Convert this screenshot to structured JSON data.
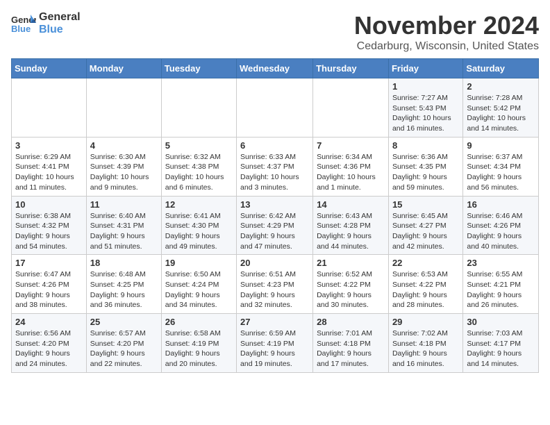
{
  "logo": {
    "general": "General",
    "blue": "Blue"
  },
  "header": {
    "month": "November 2024",
    "location": "Cedarburg, Wisconsin, United States"
  },
  "days_of_week": [
    "Sunday",
    "Monday",
    "Tuesday",
    "Wednesday",
    "Thursday",
    "Friday",
    "Saturday"
  ],
  "weeks": [
    [
      {
        "day": "",
        "info": ""
      },
      {
        "day": "",
        "info": ""
      },
      {
        "day": "",
        "info": ""
      },
      {
        "day": "",
        "info": ""
      },
      {
        "day": "",
        "info": ""
      },
      {
        "day": "1",
        "info": "Sunrise: 7:27 AM\nSunset: 5:43 PM\nDaylight: 10 hours and 16 minutes."
      },
      {
        "day": "2",
        "info": "Sunrise: 7:28 AM\nSunset: 5:42 PM\nDaylight: 10 hours and 14 minutes."
      }
    ],
    [
      {
        "day": "3",
        "info": "Sunrise: 6:29 AM\nSunset: 4:41 PM\nDaylight: 10 hours and 11 minutes."
      },
      {
        "day": "4",
        "info": "Sunrise: 6:30 AM\nSunset: 4:39 PM\nDaylight: 10 hours and 9 minutes."
      },
      {
        "day": "5",
        "info": "Sunrise: 6:32 AM\nSunset: 4:38 PM\nDaylight: 10 hours and 6 minutes."
      },
      {
        "day": "6",
        "info": "Sunrise: 6:33 AM\nSunset: 4:37 PM\nDaylight: 10 hours and 3 minutes."
      },
      {
        "day": "7",
        "info": "Sunrise: 6:34 AM\nSunset: 4:36 PM\nDaylight: 10 hours and 1 minute."
      },
      {
        "day": "8",
        "info": "Sunrise: 6:36 AM\nSunset: 4:35 PM\nDaylight: 9 hours and 59 minutes."
      },
      {
        "day": "9",
        "info": "Sunrise: 6:37 AM\nSunset: 4:34 PM\nDaylight: 9 hours and 56 minutes."
      }
    ],
    [
      {
        "day": "10",
        "info": "Sunrise: 6:38 AM\nSunset: 4:32 PM\nDaylight: 9 hours and 54 minutes."
      },
      {
        "day": "11",
        "info": "Sunrise: 6:40 AM\nSunset: 4:31 PM\nDaylight: 9 hours and 51 minutes."
      },
      {
        "day": "12",
        "info": "Sunrise: 6:41 AM\nSunset: 4:30 PM\nDaylight: 9 hours and 49 minutes."
      },
      {
        "day": "13",
        "info": "Sunrise: 6:42 AM\nSunset: 4:29 PM\nDaylight: 9 hours and 47 minutes."
      },
      {
        "day": "14",
        "info": "Sunrise: 6:43 AM\nSunset: 4:28 PM\nDaylight: 9 hours and 44 minutes."
      },
      {
        "day": "15",
        "info": "Sunrise: 6:45 AM\nSunset: 4:27 PM\nDaylight: 9 hours and 42 minutes."
      },
      {
        "day": "16",
        "info": "Sunrise: 6:46 AM\nSunset: 4:26 PM\nDaylight: 9 hours and 40 minutes."
      }
    ],
    [
      {
        "day": "17",
        "info": "Sunrise: 6:47 AM\nSunset: 4:26 PM\nDaylight: 9 hours and 38 minutes."
      },
      {
        "day": "18",
        "info": "Sunrise: 6:48 AM\nSunset: 4:25 PM\nDaylight: 9 hours and 36 minutes."
      },
      {
        "day": "19",
        "info": "Sunrise: 6:50 AM\nSunset: 4:24 PM\nDaylight: 9 hours and 34 minutes."
      },
      {
        "day": "20",
        "info": "Sunrise: 6:51 AM\nSunset: 4:23 PM\nDaylight: 9 hours and 32 minutes."
      },
      {
        "day": "21",
        "info": "Sunrise: 6:52 AM\nSunset: 4:22 PM\nDaylight: 9 hours and 30 minutes."
      },
      {
        "day": "22",
        "info": "Sunrise: 6:53 AM\nSunset: 4:22 PM\nDaylight: 9 hours and 28 minutes."
      },
      {
        "day": "23",
        "info": "Sunrise: 6:55 AM\nSunset: 4:21 PM\nDaylight: 9 hours and 26 minutes."
      }
    ],
    [
      {
        "day": "24",
        "info": "Sunrise: 6:56 AM\nSunset: 4:20 PM\nDaylight: 9 hours and 24 minutes."
      },
      {
        "day": "25",
        "info": "Sunrise: 6:57 AM\nSunset: 4:20 PM\nDaylight: 9 hours and 22 minutes."
      },
      {
        "day": "26",
        "info": "Sunrise: 6:58 AM\nSunset: 4:19 PM\nDaylight: 9 hours and 20 minutes."
      },
      {
        "day": "27",
        "info": "Sunrise: 6:59 AM\nSunset: 4:19 PM\nDaylight: 9 hours and 19 minutes."
      },
      {
        "day": "28",
        "info": "Sunrise: 7:01 AM\nSunset: 4:18 PM\nDaylight: 9 hours and 17 minutes."
      },
      {
        "day": "29",
        "info": "Sunrise: 7:02 AM\nSunset: 4:18 PM\nDaylight: 9 hours and 16 minutes."
      },
      {
        "day": "30",
        "info": "Sunrise: 7:03 AM\nSunset: 4:17 PM\nDaylight: 9 hours and 14 minutes."
      }
    ]
  ]
}
